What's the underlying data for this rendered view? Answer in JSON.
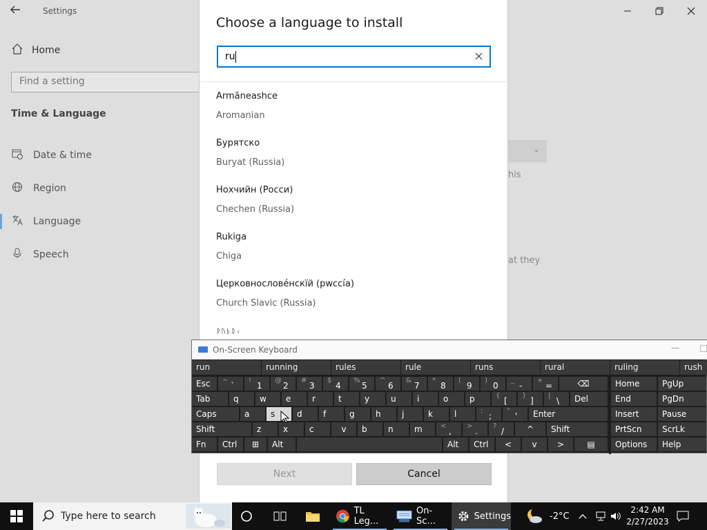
{
  "settings": {
    "title": "Settings",
    "home": "Home",
    "find_placeholder": "Find a setting",
    "section": "Time & Language",
    "nav": [
      {
        "label": "Date & time",
        "icon": "calendar-clock-icon"
      },
      {
        "label": "Region",
        "icon": "globe-icon"
      },
      {
        "label": "Language",
        "icon": "language-icon"
      },
      {
        "label": "Speech",
        "icon": "microphone-icon"
      }
    ],
    "active_nav": "Language",
    "background_text": [
      "his",
      "at they"
    ]
  },
  "dialog": {
    "title": "Choose a language to install",
    "search_value": "ru",
    "languages": [
      {
        "native": "Armãneashce",
        "english": "Aromanian"
      },
      {
        "native": "Бурятско",
        "english": "Buryat (Russia)"
      },
      {
        "native": "Нохчийн (Росси)",
        "english": "Chechen (Russia)"
      },
      {
        "native": "Rukiga",
        "english": "Chiga"
      },
      {
        "native": "Церковнослове́нскїй (рwссі́а)",
        "english": "Church Slavic (Russia)"
      }
    ],
    "partial_item": "ᚹᚢᚦᚱᚲ",
    "next_label": "Next",
    "cancel_label": "Cancel"
  },
  "osk": {
    "title": "On-Screen Keyboard",
    "suggestions": [
      "run",
      "running",
      "rules",
      "rule",
      "runs",
      "rural",
      "ruling",
      "rush"
    ],
    "rows": {
      "r1": [
        {
          "label": "Esc"
        },
        {
          "top": "~",
          "bot": "`"
        },
        {
          "top": "!",
          "bot": "1"
        },
        {
          "top": "@",
          "bot": "2"
        },
        {
          "top": "#",
          "bot": "3"
        },
        {
          "top": "$",
          "bot": "4"
        },
        {
          "top": "%",
          "bot": "5"
        },
        {
          "top": "^",
          "bot": "6"
        },
        {
          "top": "&",
          "bot": "7"
        },
        {
          "top": "*",
          "bot": "8"
        },
        {
          "top": "(",
          "bot": "9"
        },
        {
          "top": ")",
          "bot": "0"
        },
        {
          "top": "_",
          "bot": "-"
        },
        {
          "top": "+",
          "bot": "="
        },
        {
          "label": "⌫"
        }
      ],
      "r2": [
        {
          "label": "Tab"
        },
        {
          "label": "q"
        },
        {
          "label": "w"
        },
        {
          "label": "e"
        },
        {
          "label": "r"
        },
        {
          "label": "t"
        },
        {
          "label": "y"
        },
        {
          "label": "u"
        },
        {
          "label": "i"
        },
        {
          "label": "o"
        },
        {
          "label": "p"
        },
        {
          "top": "{",
          "bot": "["
        },
        {
          "top": "}",
          "bot": "]"
        },
        {
          "top": "|",
          "bot": "\\"
        },
        {
          "label": "Del"
        }
      ],
      "r3": [
        {
          "label": "Caps"
        },
        {
          "label": "a"
        },
        {
          "label": "s"
        },
        {
          "label": "d"
        },
        {
          "label": "f"
        },
        {
          "label": "g"
        },
        {
          "label": "h"
        },
        {
          "label": "j"
        },
        {
          "label": "k"
        },
        {
          "label": "l"
        },
        {
          "top": ":",
          "bot": ";"
        },
        {
          "top": "\"",
          "bot": "'"
        },
        {
          "label": "Enter"
        }
      ],
      "r4": [
        {
          "label": "Shift"
        },
        {
          "label": "z"
        },
        {
          "label": "x"
        },
        {
          "label": "c"
        },
        {
          "label": "v"
        },
        {
          "label": "b"
        },
        {
          "label": "n"
        },
        {
          "label": "m"
        },
        {
          "top": "<",
          "bot": ","
        },
        {
          "top": ">",
          "bot": "."
        },
        {
          "top": "?",
          "bot": "/"
        },
        {
          "label": "^"
        },
        {
          "label": "Shift"
        }
      ],
      "r5": [
        {
          "label": "Fn"
        },
        {
          "label": "Ctrl"
        },
        {
          "label": "⊞"
        },
        {
          "label": "Alt"
        },
        {
          "label": ""
        },
        {
          "label": "Alt"
        },
        {
          "label": "Ctrl"
        },
        {
          "label": "<"
        },
        {
          "label": "v"
        },
        {
          "label": ">"
        },
        {
          "label": "▤"
        }
      ]
    },
    "nav_keys": [
      [
        "Home",
        "PgUp"
      ],
      [
        "End",
        "PgDn"
      ],
      [
        "Insert",
        "Pause"
      ],
      [
        "PrtScn",
        "ScrLk"
      ],
      [
        "Options",
        "Help"
      ]
    ],
    "highlighted_key": "s"
  },
  "taskbar": {
    "search_placeholder": "Type here to search",
    "apps": [
      {
        "label": "TL Leg...",
        "icon": "chrome-icon"
      },
      {
        "label": "On-Sc...",
        "icon": "keyboard-app-icon"
      },
      {
        "label": "Settings",
        "icon": "gear-icon"
      }
    ],
    "weather": "-2°C",
    "time": "2:42 AM",
    "date": "2/27/2023"
  }
}
